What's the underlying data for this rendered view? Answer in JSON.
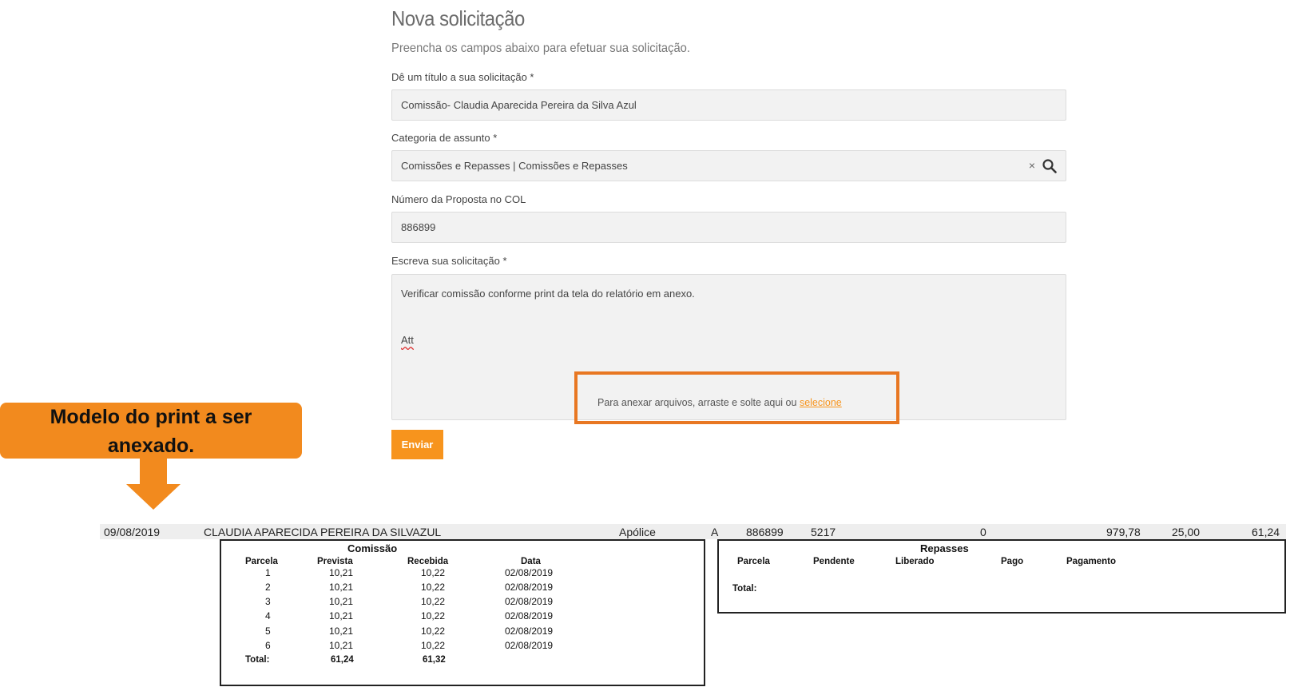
{
  "form": {
    "title": "Nova solicitação",
    "subtitle": "Preencha os campos abaixo para efetuar sua solicitação.",
    "title_label": "Dê um título a sua solicitação *",
    "title_value": "Comissão- Claudia Aparecida Pereira da Silva Azul",
    "category_label": "Categoria de assunto *",
    "category_value": "Comissões e Repasses | Comissões e Repasses",
    "category_clear": "×",
    "proposal_label": "Número da Proposta no COL",
    "proposal_value": "886899",
    "message_label": "Escreva sua solicitação *",
    "message_line1": "Verificar comissão conforme print da tela do relatório em anexo.",
    "message_line2": "Att",
    "attach_text": "Para anexar arquivos, arraste e solte aqui ou ",
    "attach_link": "selecione",
    "submit_label": "Enviar"
  },
  "callout": {
    "line1": "Modelo do print a ser",
    "line2": "anexado."
  },
  "report": {
    "row": {
      "date": "09/08/2019",
      "name": "CLAUDIA APARECIDA PEREIRA DA SILVAZUL",
      "type": "Apólice",
      "flag": "A",
      "proposal": "886899",
      "code": "5217",
      "zero": "0",
      "amount": "979,78",
      "percent": "25,00",
      "commission": "61,24"
    },
    "comissao": {
      "title": "Comissão",
      "headers": [
        "Parcela",
        "Prevista",
        "Recebida",
        "Data"
      ],
      "rows": [
        [
          "1",
          "10,21",
          "10,22",
          "02/08/2019"
        ],
        [
          "2",
          "10,21",
          "10,22",
          "02/08/2019"
        ],
        [
          "3",
          "10,21",
          "10,22",
          "02/08/2019"
        ],
        [
          "4",
          "10,21",
          "10,22",
          "02/08/2019"
        ],
        [
          "5",
          "10,21",
          "10,22",
          "02/08/2019"
        ],
        [
          "6",
          "10,21",
          "10,22",
          "02/08/2019"
        ]
      ],
      "total_label": "Total:",
      "total_prevista": "61,24",
      "total_recebida": "61,32"
    },
    "repasses": {
      "title": "Repasses",
      "headers": [
        "Parcela",
        "Pendente",
        "Liberado",
        "Pago",
        "Pagamento"
      ],
      "total_label": "Total:"
    }
  },
  "colors": {
    "accent": "#f7941d",
    "callout": "#f28a1e",
    "highlight_border": "#e87722"
  },
  "icons": [
    "search-icon",
    "clear-icon",
    "arrow-down-icon"
  ]
}
